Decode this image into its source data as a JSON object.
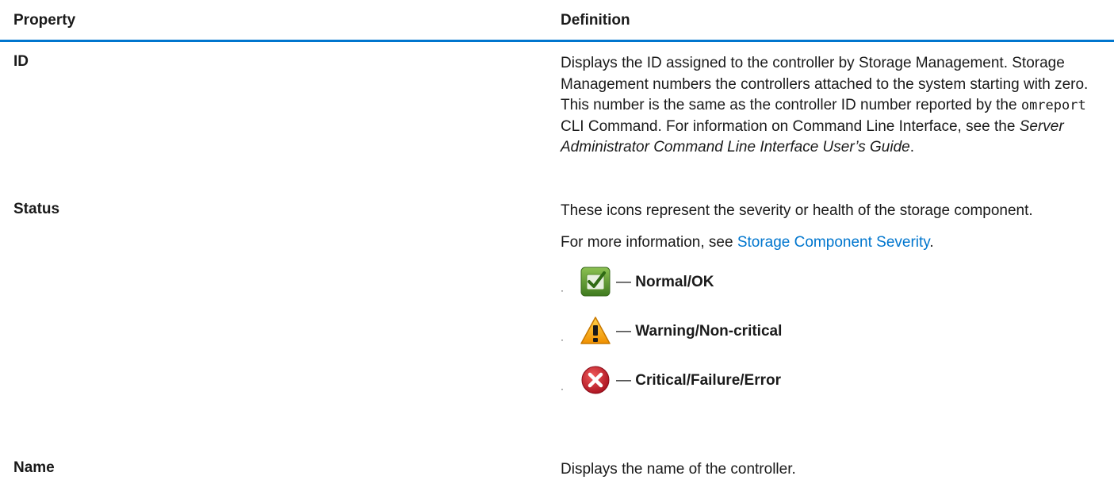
{
  "table": {
    "headers": {
      "property": "Property",
      "definition": "Definition"
    },
    "rows": {
      "id": {
        "property": "ID",
        "definition": {
          "text1": "Displays the ID assigned to the controller by Storage Management. Storage Management numbers the controllers attached to the system starting with zero. This number is the same as the controller ID number reported by the ",
          "code": "omreport",
          "text2": " CLI Command. For information on Command Line Interface, see the ",
          "guide_title": "Server Administrator Command Line Interface User’s Guide",
          "text3": "."
        }
      },
      "status": {
        "property": "Status",
        "definition": {
          "intro": "These icons represent the severity or health of the storage component.",
          "more_prefix": "For more information, see ",
          "link_text": "Storage Component Severity",
          "more_suffix": ".",
          "bullet": "·",
          "dash": "—",
          "severities": [
            {
              "icon": "check-icon",
              "label": "Normal/OK",
              "color": "#5a8f2e"
            },
            {
              "icon": "warning-icon",
              "label": "Warning/Non-critical",
              "color": "#f0a500"
            },
            {
              "icon": "error-icon",
              "label": "Critical/Failure/Error",
              "color": "#c8102e"
            }
          ]
        }
      },
      "name": {
        "property": "Name",
        "definition": "Displays the name of the controller."
      }
    }
  },
  "colors": {
    "accent_rule": "#0076ce",
    "link": "#0076ce"
  }
}
